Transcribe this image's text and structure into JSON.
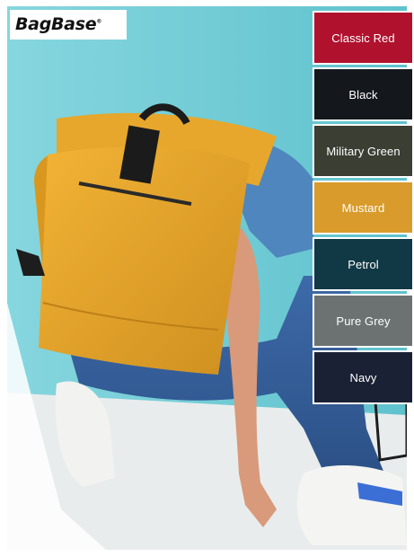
{
  "brand": {
    "name": "BagBase",
    "mark": "®"
  },
  "colour_options": [
    {
      "label": "Classic Red",
      "color": "#b0122e"
    },
    {
      "label": "Black",
      "color": "#14171c"
    },
    {
      "label": "Military Green",
      "color": "#3b3f33"
    },
    {
      "label": "Mustard",
      "color": "#d99b2b"
    },
    {
      "label": "Petrol",
      "color": "#113845"
    },
    {
      "label": "Pure Grey",
      "color": "#6c7272"
    },
    {
      "label": "Navy",
      "color": "#1b2134"
    }
  ]
}
